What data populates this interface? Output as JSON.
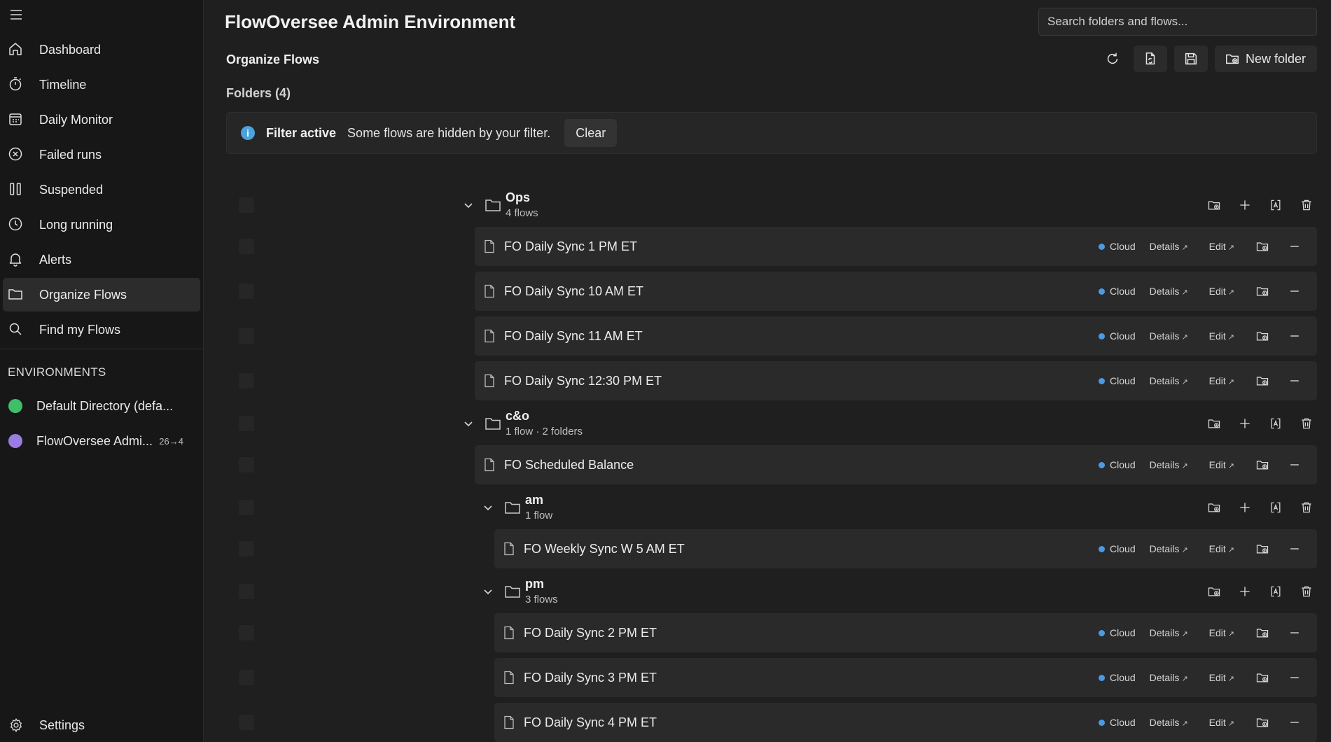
{
  "app": {
    "title": "FlowOversee Admin Environment"
  },
  "search": {
    "placeholder": "Search folders and flows..."
  },
  "sidebar": {
    "items": [
      {
        "label": "Dashboard",
        "icon": "home-icon"
      },
      {
        "label": "Timeline",
        "icon": "timer-icon"
      },
      {
        "label": "Daily Monitor",
        "icon": "calendar-icon"
      },
      {
        "label": "Failed runs",
        "icon": "error-circle-icon"
      },
      {
        "label": "Suspended",
        "icon": "pause-icon"
      },
      {
        "label": "Long running",
        "icon": "clock-icon"
      },
      {
        "label": "Alerts",
        "icon": "bell-icon"
      },
      {
        "label": "Organize Flows",
        "icon": "folder-icon",
        "active": true
      },
      {
        "label": "Find my Flows",
        "icon": "search-icon"
      }
    ],
    "environments_title": "ENVIRONMENTS",
    "environments": [
      {
        "label": "Default Directory (defa...",
        "color": "#3fbf6a",
        "badge": ""
      },
      {
        "label": "FlowOversee Admi...",
        "color": "#9a7de0",
        "badge": "26→4"
      }
    ],
    "settings_label": "Settings"
  },
  "page": {
    "section_title": "Organize Flows",
    "folders_count": "Folders (4)",
    "new_folder_label": "New folder"
  },
  "filter": {
    "title": "Filter active",
    "message": "Some flows are hidden by your filter.",
    "clear_label": "Clear"
  },
  "labels": {
    "cloud": "Cloud",
    "details": "Details",
    "edit": "Edit",
    "ext": "↗"
  },
  "tree": [
    {
      "kind": "folder",
      "level": 0,
      "name": "Ops",
      "sub": "4 flows"
    },
    {
      "kind": "flow",
      "level": 0,
      "name": "FO Daily Sync 1 PM ET"
    },
    {
      "kind": "flow",
      "level": 0,
      "name": "FO Daily Sync 10 AM ET"
    },
    {
      "kind": "flow",
      "level": 0,
      "name": "FO Daily Sync 11 AM ET"
    },
    {
      "kind": "flow",
      "level": 0,
      "name": "FO Daily Sync 12:30 PM ET"
    },
    {
      "kind": "folder",
      "level": 0,
      "name": "c&o",
      "sub": "1 flow · 2 folders"
    },
    {
      "kind": "flow",
      "level": 0,
      "name": "FO Scheduled Balance"
    },
    {
      "kind": "folder",
      "level": 1,
      "name": "am",
      "sub": "1 flow"
    },
    {
      "kind": "flow",
      "level": 1,
      "name": "FO Weekly Sync W 5 AM ET"
    },
    {
      "kind": "folder",
      "level": 1,
      "name": "pm",
      "sub": "3 flows"
    },
    {
      "kind": "flow",
      "level": 1,
      "name": "FO Daily Sync 2 PM ET"
    },
    {
      "kind": "flow",
      "level": 1,
      "name": "FO Daily Sync 3 PM ET"
    },
    {
      "kind": "flow",
      "level": 1,
      "name": "FO Daily Sync 4 PM ET"
    }
  ]
}
